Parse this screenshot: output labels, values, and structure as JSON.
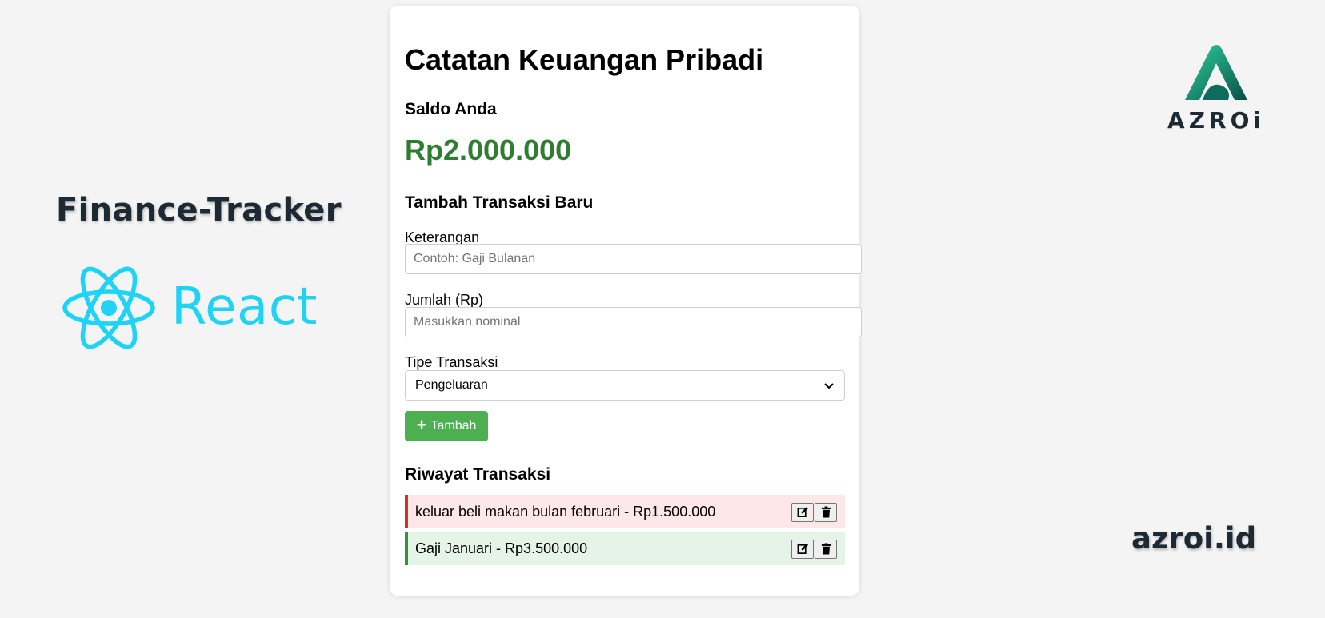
{
  "promo": {
    "title": "Finance-Tracker",
    "framework": "React",
    "brand": "AZROi",
    "domain": "azroi.id",
    "react_color": "#1fd3f5"
  },
  "app": {
    "title": "Catatan Keuangan Pribadi",
    "balance_heading": "Saldo Anda",
    "balance": "Rp2.000.000",
    "balance_color": "#2e7d32",
    "form": {
      "heading": "Tambah Transaksi Baru",
      "description_label": "Keterangan",
      "description_placeholder": "Contoh: Gaji Bulanan",
      "description_value": "",
      "amount_label": "Jumlah (Rp)",
      "amount_placeholder": "Masukkan nominal",
      "amount_value": "",
      "type_label": "Tipe Transaksi",
      "type_selected": "Pengeluaran",
      "add_button": "Tambah",
      "add_button_color": "#4caf50"
    },
    "history": {
      "heading": "Riwayat Transaksi",
      "items": [
        {
          "text": "keluar beli makan bulan februari - Rp1.500.000",
          "type": "expense",
          "color": "#d32f2f"
        },
        {
          "text": "Gaji Januari - Rp3.500.000",
          "type": "income",
          "color": "#388e3c"
        }
      ],
      "icons": {
        "edit": "edit-icon",
        "delete": "trash-icon"
      }
    }
  }
}
